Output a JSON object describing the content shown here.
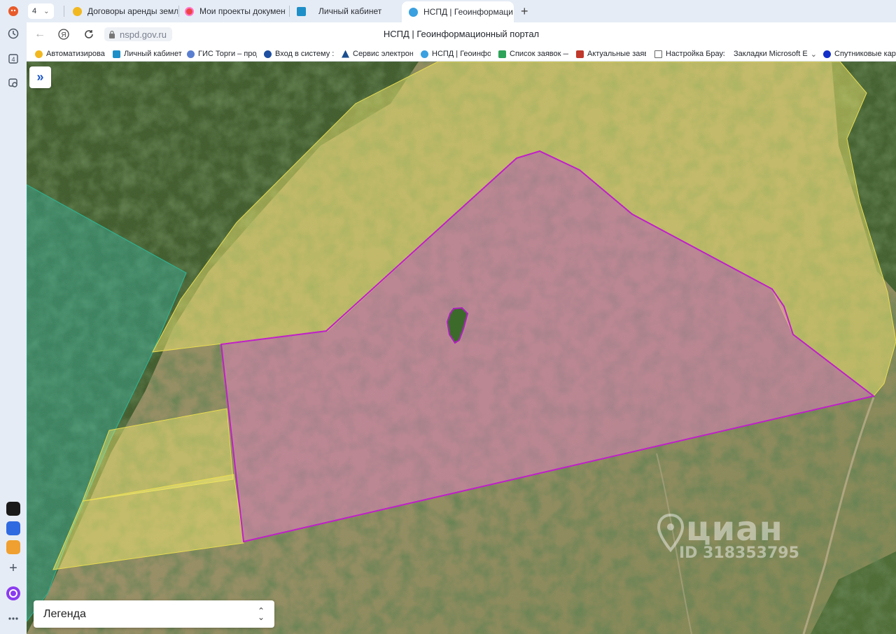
{
  "browser": {
    "tab_count": "4",
    "tabs": [
      {
        "label": "Договоры аренды земли"
      },
      {
        "label": "Мои проекты документов"
      },
      {
        "label": "Личный кабинет"
      },
      {
        "label": "НСПД | Геоинформаци"
      }
    ],
    "address": {
      "url": "nspd.gov.ru",
      "title": "НСПД | Геоинформационный портал"
    },
    "bookmarks": [
      {
        "label": "Автоматизирован"
      },
      {
        "label": "Личный кабинет"
      },
      {
        "label": "ГИС Торги – прод"
      },
      {
        "label": "Вход в систему :: I"
      },
      {
        "label": "Сервис электрон"
      },
      {
        "label": "НСПД | Геоинфор"
      },
      {
        "label": "Список заявок —"
      },
      {
        "label": "Актуальные заяв"
      },
      {
        "label": "Настройка Брауз"
      },
      {
        "label": "Закладки Microsoft E"
      },
      {
        "label": "Спутниковые карт"
      }
    ]
  },
  "map": {
    "legend_label": "Легенда",
    "watermark_brand": "циан",
    "watermark_id": "ID 318353795",
    "colors": {
      "selected_parcel_outline": "#c020c8",
      "selected_parcel_fill": "#d882b8",
      "parcel_fill_yellow": "#f2ea70",
      "zone_fill_teal": "#3ab8a8"
    }
  }
}
